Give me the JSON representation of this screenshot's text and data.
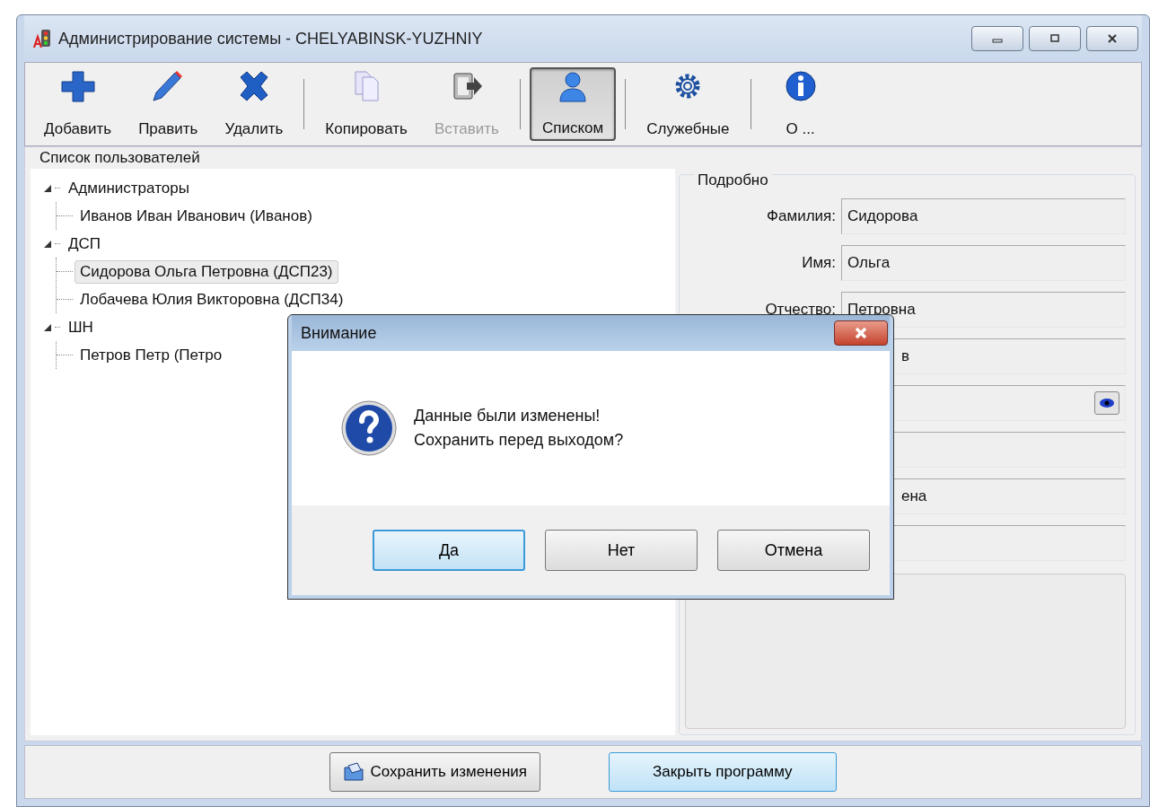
{
  "window": {
    "title": "Администрирование системы - CHELYABINSK-YUZHNIY"
  },
  "toolbar": [
    {
      "label": "Добавить",
      "disabled": false,
      "selected": false
    },
    {
      "label": "Править",
      "disabled": false,
      "selected": false
    },
    {
      "label": "Удалить",
      "disabled": false,
      "selected": false
    },
    {
      "label": "Копировать",
      "disabled": false,
      "selected": false
    },
    {
      "label": "Вставить",
      "disabled": true,
      "selected": false
    },
    {
      "label": "Списком",
      "disabled": false,
      "selected": true
    },
    {
      "label": "Служебные",
      "disabled": false,
      "selected": false
    },
    {
      "label": "О ...",
      "disabled": false,
      "selected": false
    }
  ],
  "users_group": {
    "title": "Список пользователей"
  },
  "tree": [
    {
      "label": "Администраторы",
      "expanded": true,
      "selected": false,
      "children": [
        {
          "label": "Иванов Иван Иванович (Иванов)",
          "selected": false
        }
      ]
    },
    {
      "label": "ДСП",
      "expanded": true,
      "selected": false,
      "children": [
        {
          "label": "Сидорова Ольга Петровна (ДСП23)",
          "selected": true
        },
        {
          "label": "Лобачева Юлия Викторовна (ДСП34)",
          "selected": false
        }
      ]
    },
    {
      "label": "ШН",
      "expanded": true,
      "selected": false,
      "children": [
        {
          "label": "Петров Петр (Петро",
          "selected": false
        }
      ]
    }
  ],
  "details": {
    "title": "Подробно",
    "fields": [
      {
        "kind": "text",
        "label": "Фамилия:",
        "value": "Сидорова"
      },
      {
        "kind": "text",
        "label": "Имя:",
        "value": "Ольга"
      },
      {
        "kind": "text",
        "label": "Отчество:",
        "value": "Петровна"
      },
      {
        "kind": "covered",
        "value": "в"
      },
      {
        "kind": "picker"
      },
      {
        "kind": "covered"
      },
      {
        "kind": "covered",
        "value": "ена"
      },
      {
        "kind": "covered"
      }
    ]
  },
  "bottom_buttons": [
    {
      "label": "Сохранить изменения",
      "default": false
    },
    {
      "label": "Закрыть программу",
      "default": true
    }
  ],
  "dialog": {
    "title": "Внимание",
    "lines": [
      "Данные были изменены!",
      "Сохранить перед выходом?"
    ],
    "buttons": [
      {
        "label": "Да",
        "default": true
      },
      {
        "label": "Нет",
        "default": false
      },
      {
        "label": "Отмена",
        "default": false
      }
    ]
  }
}
